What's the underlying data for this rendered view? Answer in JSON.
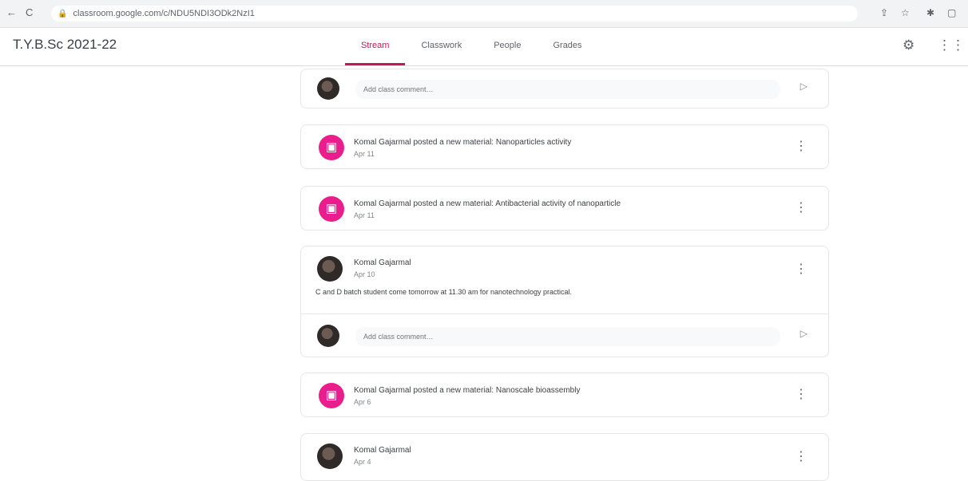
{
  "browser": {
    "back_icon": "←",
    "reload_icon": "C",
    "url": "classroom.google.com/c/NDU5NDI3ODk2NzI1"
  },
  "header": {
    "class_title": "T.Y.B.Sc 2021-22",
    "tabs": [
      {
        "label": "Stream",
        "active": true
      },
      {
        "label": "Classwork",
        "active": false
      },
      {
        "label": "People",
        "active": false
      },
      {
        "label": "Grades",
        "active": false
      }
    ]
  },
  "comment_placeholder": "Add class comment…",
  "stream": {
    "material_1": {
      "title": "Komal Gajarmal posted a new material: Nanoparticles activity",
      "date": "Apr 11"
    },
    "material_2": {
      "title": "Komal Gajarmal posted a new material: Antibacterial activity of nanoparticle",
      "date": "Apr 11"
    },
    "announcement_1": {
      "author": "Komal Gajarmal",
      "date": "Apr 10",
      "body": "C and D batch student come tomorrow at 11.30 am for nanotechnology practical."
    },
    "material_3": {
      "title": "Komal Gajarmal posted a new material: Nanoscale bioassembly",
      "date": "Apr 6"
    },
    "announcement_2": {
      "author": "Komal Gajarmal",
      "date": "Apr 4"
    }
  },
  "colors": {
    "accent": "#c2185b",
    "material_icon_bg": "#e91e8c"
  }
}
